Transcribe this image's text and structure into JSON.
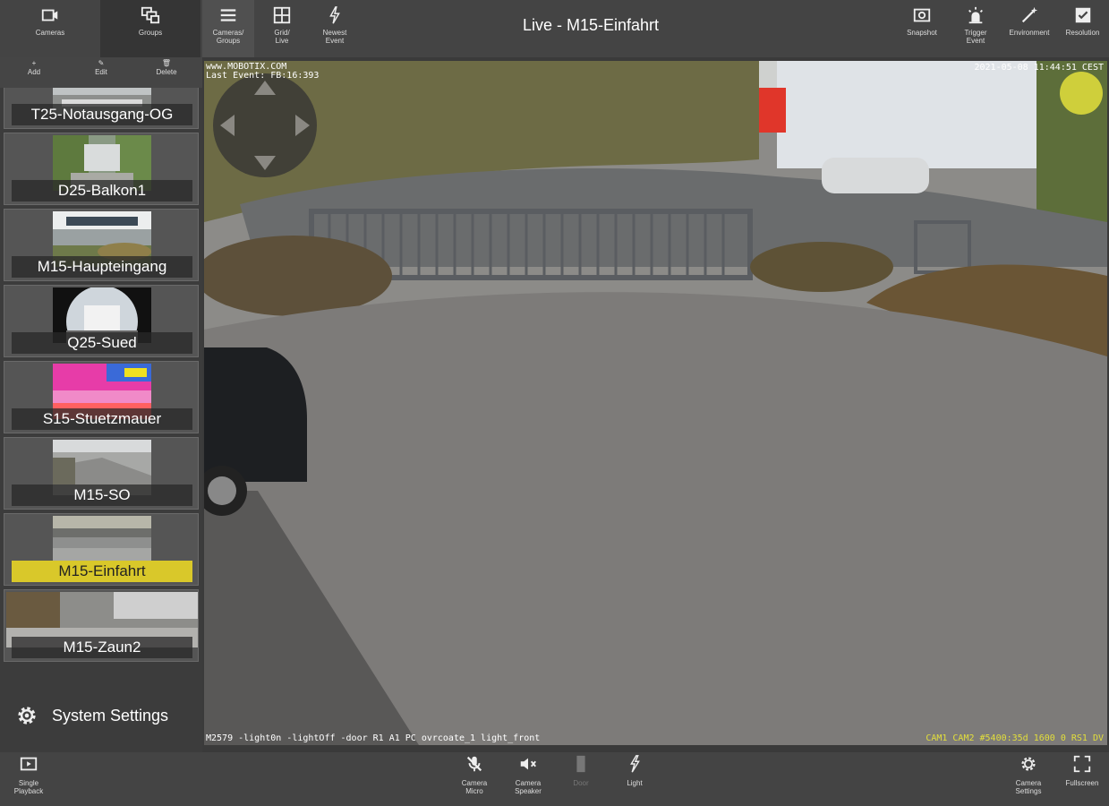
{
  "window": {
    "title": "Live - M15-Einfahrt"
  },
  "topbar": {
    "left": [
      {
        "id": "cameras",
        "label": "Cameras",
        "icon": "camera-icon"
      },
      {
        "id": "groups",
        "label": "Groups",
        "icon": "groups-icon",
        "active": true
      },
      {
        "id": "cameras-groups",
        "label": "Cameras/\nGroups",
        "icon": "menu-icon"
      },
      {
        "id": "grid-live",
        "label": "Grid/\nLive",
        "icon": "grid-icon"
      },
      {
        "id": "newest-event",
        "label": "Newest\nEvent",
        "icon": "event-icon"
      }
    ],
    "right": [
      {
        "id": "snapshot",
        "label": "Snapshot",
        "icon": "snapshot-icon"
      },
      {
        "id": "trigger-event",
        "label": "Trigger\nEvent",
        "icon": "siren-icon"
      },
      {
        "id": "environment",
        "label": "Environment",
        "icon": "wand-icon"
      },
      {
        "id": "resolution",
        "label": "Resolution",
        "icon": "check-icon"
      }
    ]
  },
  "sidebar": {
    "actions": [
      {
        "label": "+\nAdd",
        "icon": "add-icon"
      },
      {
        "label": "✎\nEdit",
        "icon": "edit-icon"
      },
      {
        "label": "🗑\nDelete",
        "icon": "delete-icon"
      }
    ],
    "cameras": [
      {
        "name": "T25-Notausgang-OG"
      },
      {
        "name": "D25-Balkon1"
      },
      {
        "name": "M15-Haupteingang"
      },
      {
        "name": "Q25-Sued"
      },
      {
        "name": "S15-Stuetzmauer"
      },
      {
        "name": "M15-SO"
      },
      {
        "name": "M15-Einfahrt",
        "selected": true
      },
      {
        "name": "M15-Zaun2"
      }
    ],
    "system_settings": "System Settings"
  },
  "video": {
    "overlay_top_left": "www.MOBOTIX.COM\nLast Event: FB:16:393",
    "overlay_top_right": "2021-05-08 11:44:51 CEST",
    "overlay_bottom_left": "M2579 -light0n -lightOff -door R1 A1 PC ovrcoate_1 light_front",
    "overlay_bottom_right": "CAM1 CAM2 #5400:35d 1600 0 RS1 DV"
  },
  "bottombar": {
    "left": {
      "label": "Single\nPlayback",
      "icon": "playback-icon"
    },
    "center": [
      {
        "label": "Camera\nMicro",
        "icon": "mic-off-icon"
      },
      {
        "label": "Camera\nSpeaker",
        "icon": "speaker-off-icon"
      },
      {
        "label": "Door",
        "icon": "door-icon",
        "disabled": true
      },
      {
        "label": "Light",
        "icon": "light-icon"
      }
    ],
    "right": [
      {
        "label": "Camera\nSettings",
        "icon": "gear-icon"
      },
      {
        "label": "Fullscreen",
        "icon": "fullscreen-icon"
      }
    ]
  },
  "colors": {
    "accent": "#d9c82a",
    "bar": "#444444",
    "sidebar": "#3c3c3c"
  }
}
